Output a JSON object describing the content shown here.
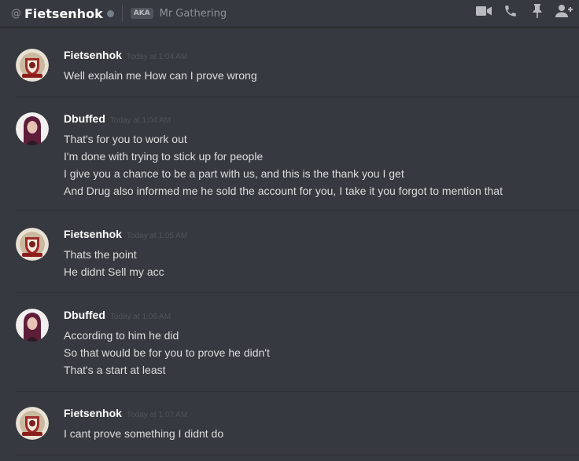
{
  "header": {
    "at_symbol": "@",
    "channel_name": "Fietsenhok",
    "aka_badge": "AKA",
    "aka_name": "Mr Gathering",
    "icons": [
      "video-call-icon",
      "voice-call-icon",
      "pin-icon",
      "add-friend-icon"
    ]
  },
  "messages": [
    {
      "username": "Fietsenhok",
      "timestamp": "Today at 1:04 AM",
      "avatar": "crest-avatar",
      "lines": [
        "Well explain me How can I prove wrong"
      ]
    },
    {
      "username": "Dbuffed",
      "timestamp": "Today at 1:04 AM",
      "avatar": "person-avatar",
      "lines": [
        "That's for you to work out",
        "I'm done with trying to stick up for people",
        "I give you a chance to be a part with us, and this is the thank you I get",
        "And Drug also informed me he sold the account for you, I take it you forgot to mention that"
      ]
    },
    {
      "username": "Fietsenhok",
      "timestamp": "Today at 1:05 AM",
      "avatar": "crest-avatar",
      "lines": [
        "Thats the point",
        "He didnt Sell my acc"
      ]
    },
    {
      "username": "Dbuffed",
      "timestamp": "Today at 1:06 AM",
      "avatar": "person-avatar",
      "lines": [
        "According to him he did",
        "So that would be for you to prove he didn't",
        "That's a start at least"
      ]
    },
    {
      "username": "Fietsenhok",
      "timestamp": "Today at 1:07 AM",
      "avatar": "crest-avatar",
      "lines": [
        "I cant prove something I didnt do"
      ]
    }
  ]
}
